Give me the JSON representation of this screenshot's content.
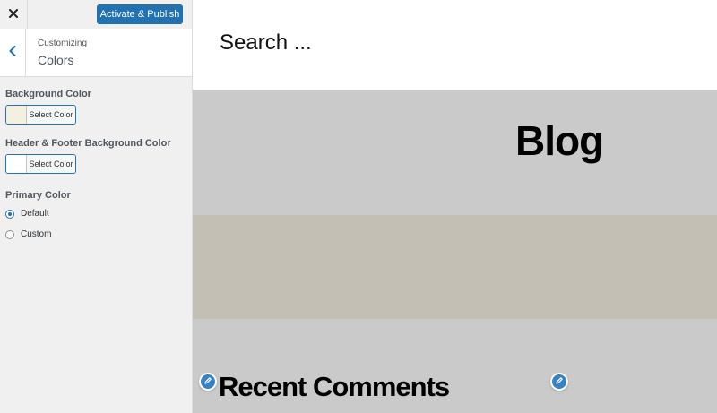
{
  "topbar": {
    "close_icon": "close-icon",
    "publish_label": "Activate & Publish"
  },
  "section": {
    "back_icon": "chevron-left-icon",
    "subtitle": "Customizing",
    "title": "Colors"
  },
  "controls": {
    "background_color": {
      "label": "Background Color",
      "button_label": "Select Color",
      "swatch": "#f5efe0"
    },
    "header_footer_color": {
      "label": "Header & Footer Background Color",
      "button_label": "Select Color",
      "swatch": "#ffffff"
    },
    "primary_color": {
      "label": "Primary Color",
      "options": [
        {
          "label": "Default",
          "checked": true
        },
        {
          "label": "Custom",
          "checked": false
        }
      ]
    }
  },
  "preview": {
    "search_text": "Search ...",
    "blog_title": "Blog",
    "comments_title": "Recent Comments",
    "edit_icon": "pencil-icon"
  },
  "colors": {
    "accent": "#2271b1",
    "sidebar_bg": "#f0f0f1",
    "preview_band": "#cacaca",
    "preview_image": "#c4bfb5"
  }
}
